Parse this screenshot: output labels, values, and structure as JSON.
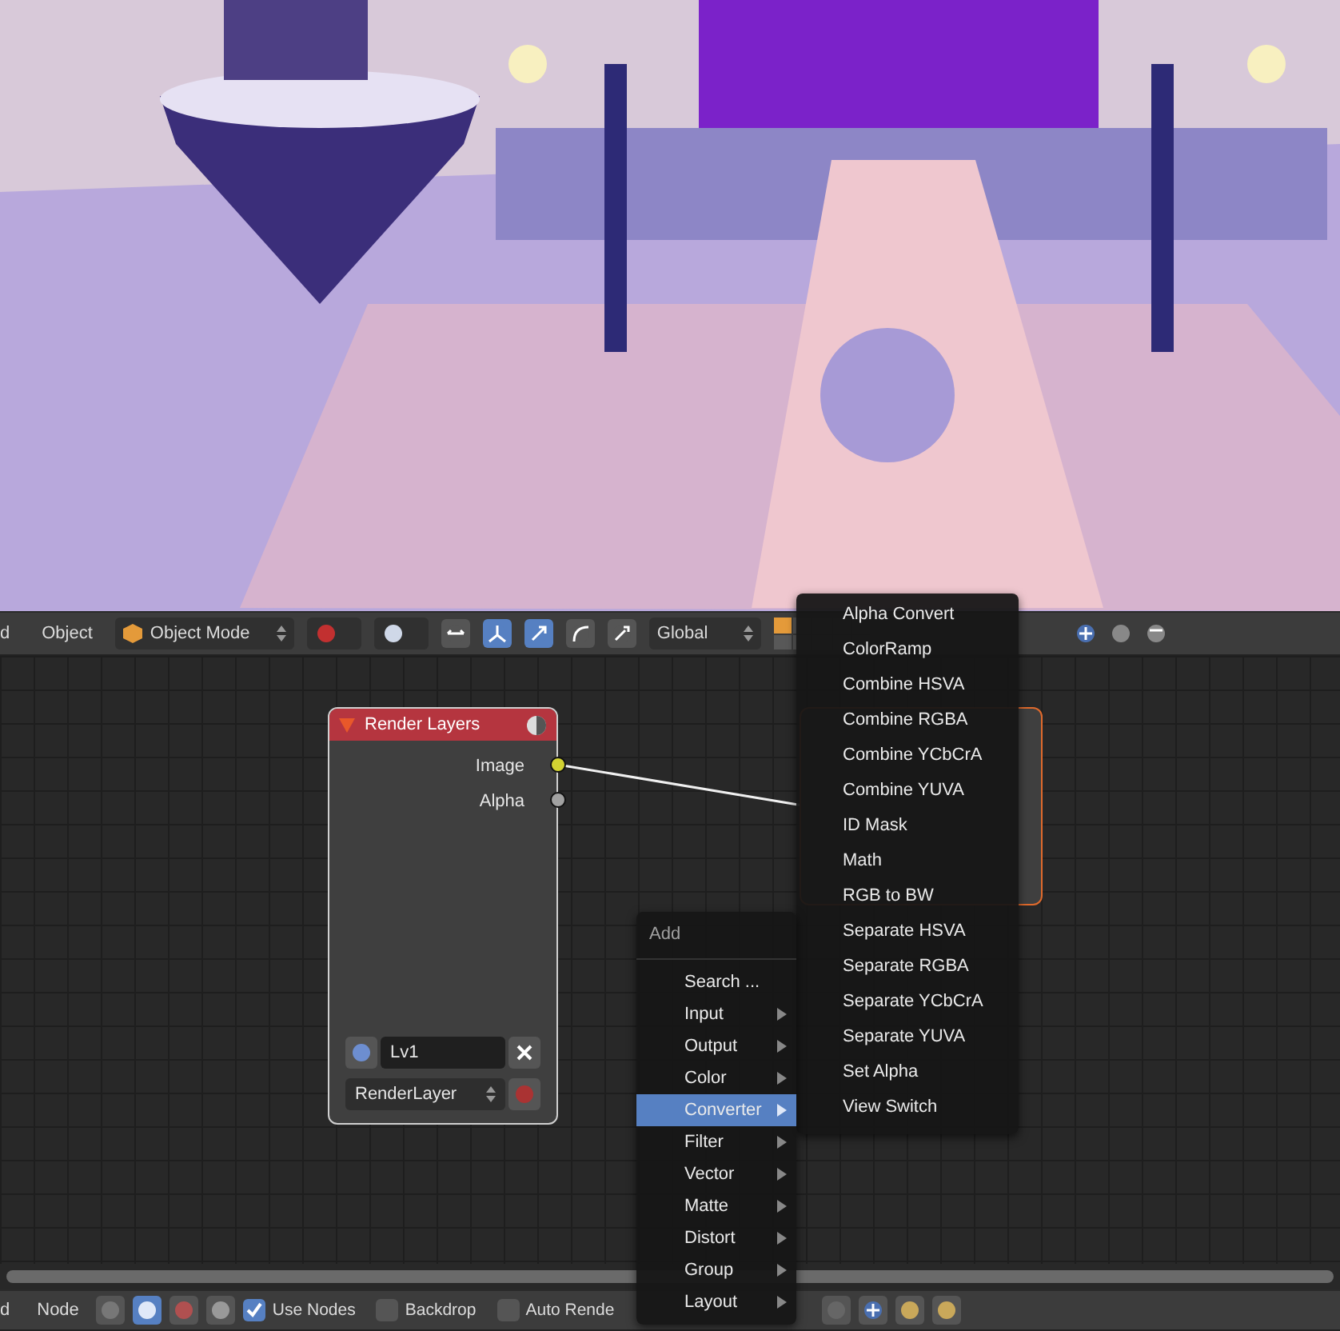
{
  "viewport_header": {
    "menu_cut": "d",
    "menu": "Object",
    "mode": "Object Mode",
    "orientation": "Global"
  },
  "render_node": {
    "title": "Render Layers",
    "layer": "Lv1",
    "scene_layer": "RenderLayer",
    "outputs": [
      {
        "label": "Image",
        "color": "#d2d232"
      },
      {
        "label": "Alpha",
        "color": "#a1a1a1"
      }
    ]
  },
  "add_menu": {
    "title": "Add",
    "items": [
      {
        "label": "Search ...",
        "has_arrow": false,
        "selected": false
      },
      {
        "label": "Input",
        "has_arrow": true,
        "selected": false
      },
      {
        "label": "Output",
        "has_arrow": true,
        "selected": false
      },
      {
        "label": "Color",
        "has_arrow": true,
        "selected": false
      },
      {
        "label": "Converter",
        "has_arrow": true,
        "selected": true
      },
      {
        "label": "Filter",
        "has_arrow": true,
        "selected": false
      },
      {
        "label": "Vector",
        "has_arrow": true,
        "selected": false
      },
      {
        "label": "Matte",
        "has_arrow": true,
        "selected": false
      },
      {
        "label": "Distort",
        "has_arrow": true,
        "selected": false
      },
      {
        "label": "Group",
        "has_arrow": true,
        "selected": false
      },
      {
        "label": "Layout",
        "has_arrow": true,
        "selected": false
      }
    ]
  },
  "converter_menu": {
    "items": [
      "Alpha Convert",
      "ColorRamp",
      "Combine HSVA",
      "Combine RGBA",
      "Combine YCbCrA",
      "Combine YUVA",
      "ID Mask",
      "Math",
      "RGB to BW",
      "Separate HSVA",
      "Separate RGBA",
      "Separate YCbCrA",
      "Separate YUVA",
      "Set Alpha",
      "View Switch"
    ]
  },
  "node_header": {
    "menu_cut": "d",
    "menu": "Node",
    "options": [
      {
        "label": "Use Nodes",
        "checked": true
      },
      {
        "label": "Backdrop",
        "checked": false
      },
      {
        "label": "Auto Rende",
        "checked": false
      }
    ]
  }
}
